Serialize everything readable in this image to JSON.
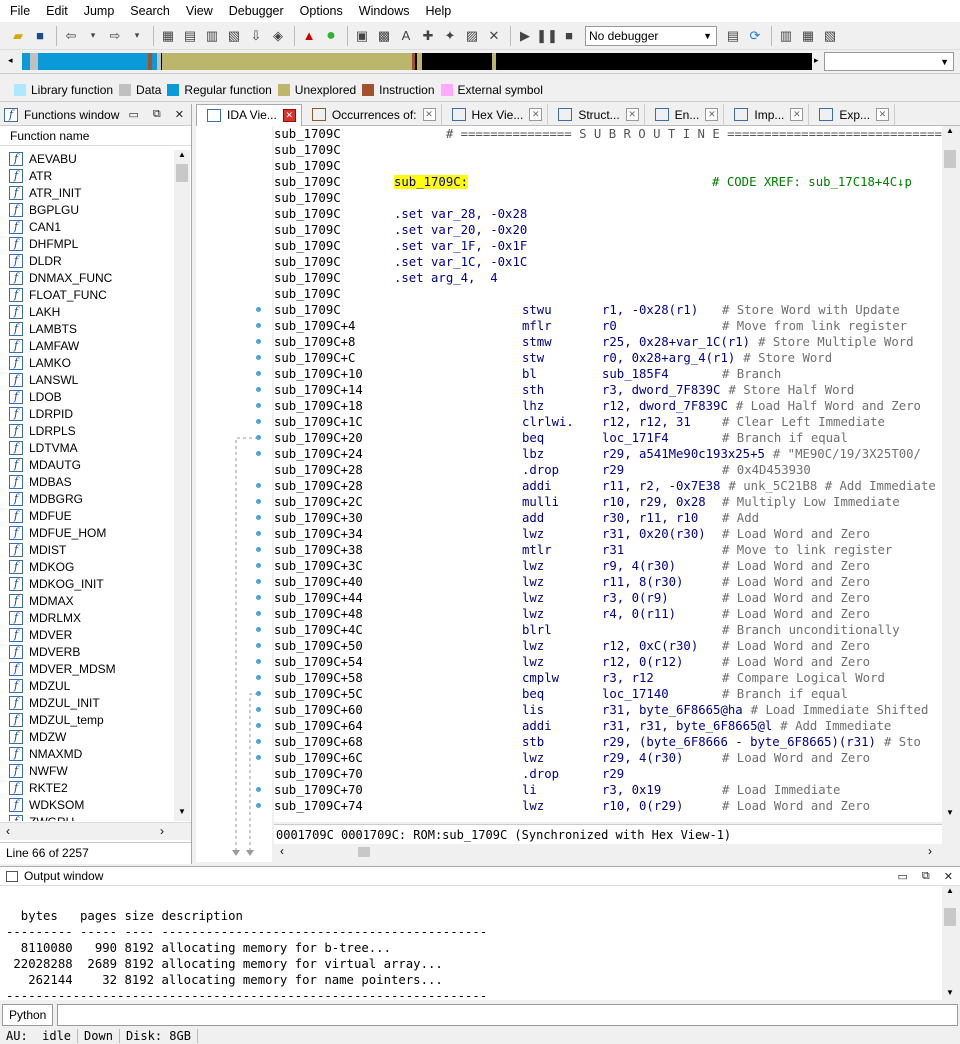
{
  "menu": [
    "File",
    "Edit",
    "Jump",
    "Search",
    "View",
    "Debugger",
    "Options",
    "Windows",
    "Help"
  ],
  "toolbar": {
    "debugger_select": "No debugger"
  },
  "legend": [
    {
      "label": "Library function",
      "color": "#aee8ff"
    },
    {
      "label": "Data",
      "color": "#c0c0c0"
    },
    {
      "label": "Regular function",
      "color": "#0a9ad8"
    },
    {
      "label": "Unexplored",
      "color": "#bcb66c"
    },
    {
      "label": "Instruction",
      "color": "#a0522d"
    },
    {
      "label": "External symbol",
      "color": "#ffaaff"
    }
  ],
  "functions_window": {
    "title": "Functions window",
    "column": "Function name",
    "items": [
      "AEVABU",
      "ATR",
      "ATR_INIT",
      "BGPLGU",
      "CAN1",
      "DHFMPL",
      "DLDR",
      "DNMAX_FUNC",
      "FLOAT_FUNC",
      "LAKH",
      "LAMBTS",
      "LAMFAW",
      "LAMKO",
      "LANSWL",
      "LDOB",
      "LDRPID",
      "LDRPLS",
      "LDTVMA",
      "MDAUTG",
      "MDBAS",
      "MDBGRG",
      "MDFUE",
      "MDFUE_HOM",
      "MDIST",
      "MDKOG",
      "MDKOG_INIT",
      "MDMAX",
      "MDRLMX",
      "MDVER",
      "MDVERB",
      "MDVER_MDSM",
      "MDZUL",
      "MDZUL_INIT",
      "MDZUL_temp",
      "MDZW",
      "NMAXMD",
      "NWFW",
      "RKTE2",
      "WDKSOM",
      "ZWGRU"
    ],
    "status": "Line 66 of 2257"
  },
  "tabs": [
    {
      "label": "IDA Vie...",
      "active": true
    },
    {
      "label": "Occurrences of:"
    },
    {
      "label": "Hex Vie..."
    },
    {
      "label": "Struct..."
    },
    {
      "label": "En..."
    },
    {
      "label": "Imp..."
    },
    {
      "label": "Exp..."
    }
  ],
  "ida_view": {
    "lines": [
      {
        "addr": "sub_1709C",
        "text": "       # =============== S U B R O U T I N E ======================================="
      },
      {
        "addr": "sub_1709C",
        "text": ""
      },
      {
        "addr": "sub_1709C",
        "text": ""
      },
      {
        "addr": "sub_1709C",
        "label": "sub_1709C:",
        "comment": "# CODE XREF: sub_17C18+4C↓p"
      },
      {
        "addr": "sub_1709C",
        "text": ""
      },
      {
        "addr": "sub_1709C",
        "set": ".set var_28, -0x28"
      },
      {
        "addr": "sub_1709C",
        "set": ".set var_20, -0x20"
      },
      {
        "addr": "sub_1709C",
        "set": ".set var_1F, -0x1F"
      },
      {
        "addr": "sub_1709C",
        "set": ".set var_1C, -0x1C"
      },
      {
        "addr": "sub_1709C",
        "set": ".set arg_4,  4"
      },
      {
        "addr": "sub_1709C",
        "text": ""
      },
      {
        "addr": "sub_1709C",
        "mn": "stwu",
        "op": "r1, -0x28(r1)",
        "cmt": "# Store Word with Update"
      },
      {
        "addr": "sub_1709C+4",
        "mn": "mflr",
        "op": "r0",
        "cmt": "# Move from link register"
      },
      {
        "addr": "sub_1709C+8",
        "mn": "stmw",
        "op": "r25, 0x28+var_1C(r1)",
        "cmt": "# Store Multiple Word"
      },
      {
        "addr": "sub_1709C+C",
        "mn": "stw",
        "op": "r0, 0x28+arg_4(r1)",
        "cmt": "# Store Word"
      },
      {
        "addr": "sub_1709C+10",
        "mn": "bl",
        "op": "sub_185F4",
        "cmt": "# Branch"
      },
      {
        "addr": "sub_1709C+14",
        "mn": "sth",
        "op": "r3, dword_7F839C",
        "cmt": "# Store Half Word"
      },
      {
        "addr": "sub_1709C+18",
        "mn": "lhz",
        "op": "r12, dword_7F839C",
        "cmt": "# Load Half Word and Zero"
      },
      {
        "addr": "sub_1709C+1C",
        "mn": "clrlwi.",
        "op": "r12, r12, 31",
        "cmt": "# Clear Left Immediate"
      },
      {
        "addr": "sub_1709C+20",
        "mn": "beq",
        "op": "loc_171F4",
        "cmt": "# Branch if equal"
      },
      {
        "addr": "sub_1709C+24",
        "mn": "lbz",
        "op": "r29, a541Me90c193x25+5",
        "cmt": "# \"ME90C/19/3X25T00/"
      },
      {
        "addr": "sub_1709C+28",
        "mn": ".drop",
        "op": "r29",
        "cmt": "# 0x4D453930"
      },
      {
        "addr": "sub_1709C+28",
        "mn": "addi",
        "op": "r11, r2, -0x7E38",
        "cmt": "# unk_5C21B8 # Add Immediate"
      },
      {
        "addr": "sub_1709C+2C",
        "mn": "mulli",
        "op": "r10, r29, 0x28",
        "cmt": "# Multiply Low Immediate"
      },
      {
        "addr": "sub_1709C+30",
        "mn": "add",
        "op": "r30, r11, r10",
        "cmt": "# Add"
      },
      {
        "addr": "sub_1709C+34",
        "mn": "lwz",
        "op": "r31, 0x20(r30)",
        "cmt": "# Load Word and Zero"
      },
      {
        "addr": "sub_1709C+38",
        "mn": "mtlr",
        "op": "r31",
        "cmt": "# Move to link register"
      },
      {
        "addr": "sub_1709C+3C",
        "mn": "lwz",
        "op": "r9, 4(r30)",
        "cmt": "# Load Word and Zero"
      },
      {
        "addr": "sub_1709C+40",
        "mn": "lwz",
        "op": "r11, 8(r30)",
        "cmt": "# Load Word and Zero"
      },
      {
        "addr": "sub_1709C+44",
        "mn": "lwz",
        "op": "r3, 0(r9)",
        "cmt": "# Load Word and Zero"
      },
      {
        "addr": "sub_1709C+48",
        "mn": "lwz",
        "op": "r4, 0(r11)",
        "cmt": "# Load Word and Zero"
      },
      {
        "addr": "sub_1709C+4C",
        "mn": "blrl",
        "op": "",
        "cmt": "# Branch unconditionally"
      },
      {
        "addr": "sub_1709C+50",
        "mn": "lwz",
        "op": "r12, 0xC(r30)",
        "cmt": "# Load Word and Zero"
      },
      {
        "addr": "sub_1709C+54",
        "mn": "lwz",
        "op": "r12, 0(r12)",
        "cmt": "# Load Word and Zero"
      },
      {
        "addr": "sub_1709C+58",
        "mn": "cmplw",
        "op": "r3, r12",
        "cmt": "# Compare Logical Word"
      },
      {
        "addr": "sub_1709C+5C",
        "mn": "beq",
        "op": "loc_17140",
        "cmt": "# Branch if equal"
      },
      {
        "addr": "sub_1709C+60",
        "mn": "lis",
        "op": "r31, byte_6F8665@ha",
        "cmt": "# Load Immediate Shifted"
      },
      {
        "addr": "sub_1709C+64",
        "mn": "addi",
        "op": "r31, r31, byte_6F8665@l",
        "cmt": "# Add Immediate"
      },
      {
        "addr": "sub_1709C+68",
        "mn": "stb",
        "op": "r29, (byte_6F8666 - byte_6F8665)(r31)",
        "cmt": "# Sto"
      },
      {
        "addr": "sub_1709C+6C",
        "mn": "lwz",
        "op": "r29, 4(r30)",
        "cmt": "# Load Word and Zero"
      },
      {
        "addr": "sub_1709C+70",
        "mn": ".drop",
        "op": "r29",
        "cmt": ""
      },
      {
        "addr": "sub_1709C+70",
        "mn": "li",
        "op": "r3, 0x19",
        "cmt": "# Load Immediate"
      },
      {
        "addr": "sub_1709C+74",
        "mn": "lwz",
        "op": "r10, 0(r29)",
        "cmt": "# Load Word and Zero"
      }
    ],
    "status": "0001709C 0001709C: ROM:sub_1709C (Synchronized with Hex View-1)"
  },
  "output_window": {
    "title": "Output window",
    "lines": [
      "  bytes   pages size description",
      "--------- ----- ---- --------------------------------------------",
      "  8110080   990 8192 allocating memory for b-tree...",
      " 22028288  2689 8192 allocating memory for virtual array...",
      "   262144    32 8192 allocating memory for name pointers...",
      "-----------------------------------------------------------------"
    ]
  },
  "python_button": "Python",
  "statusbar": [
    "AU:  idle",
    "Down",
    "Disk: 8GB"
  ]
}
